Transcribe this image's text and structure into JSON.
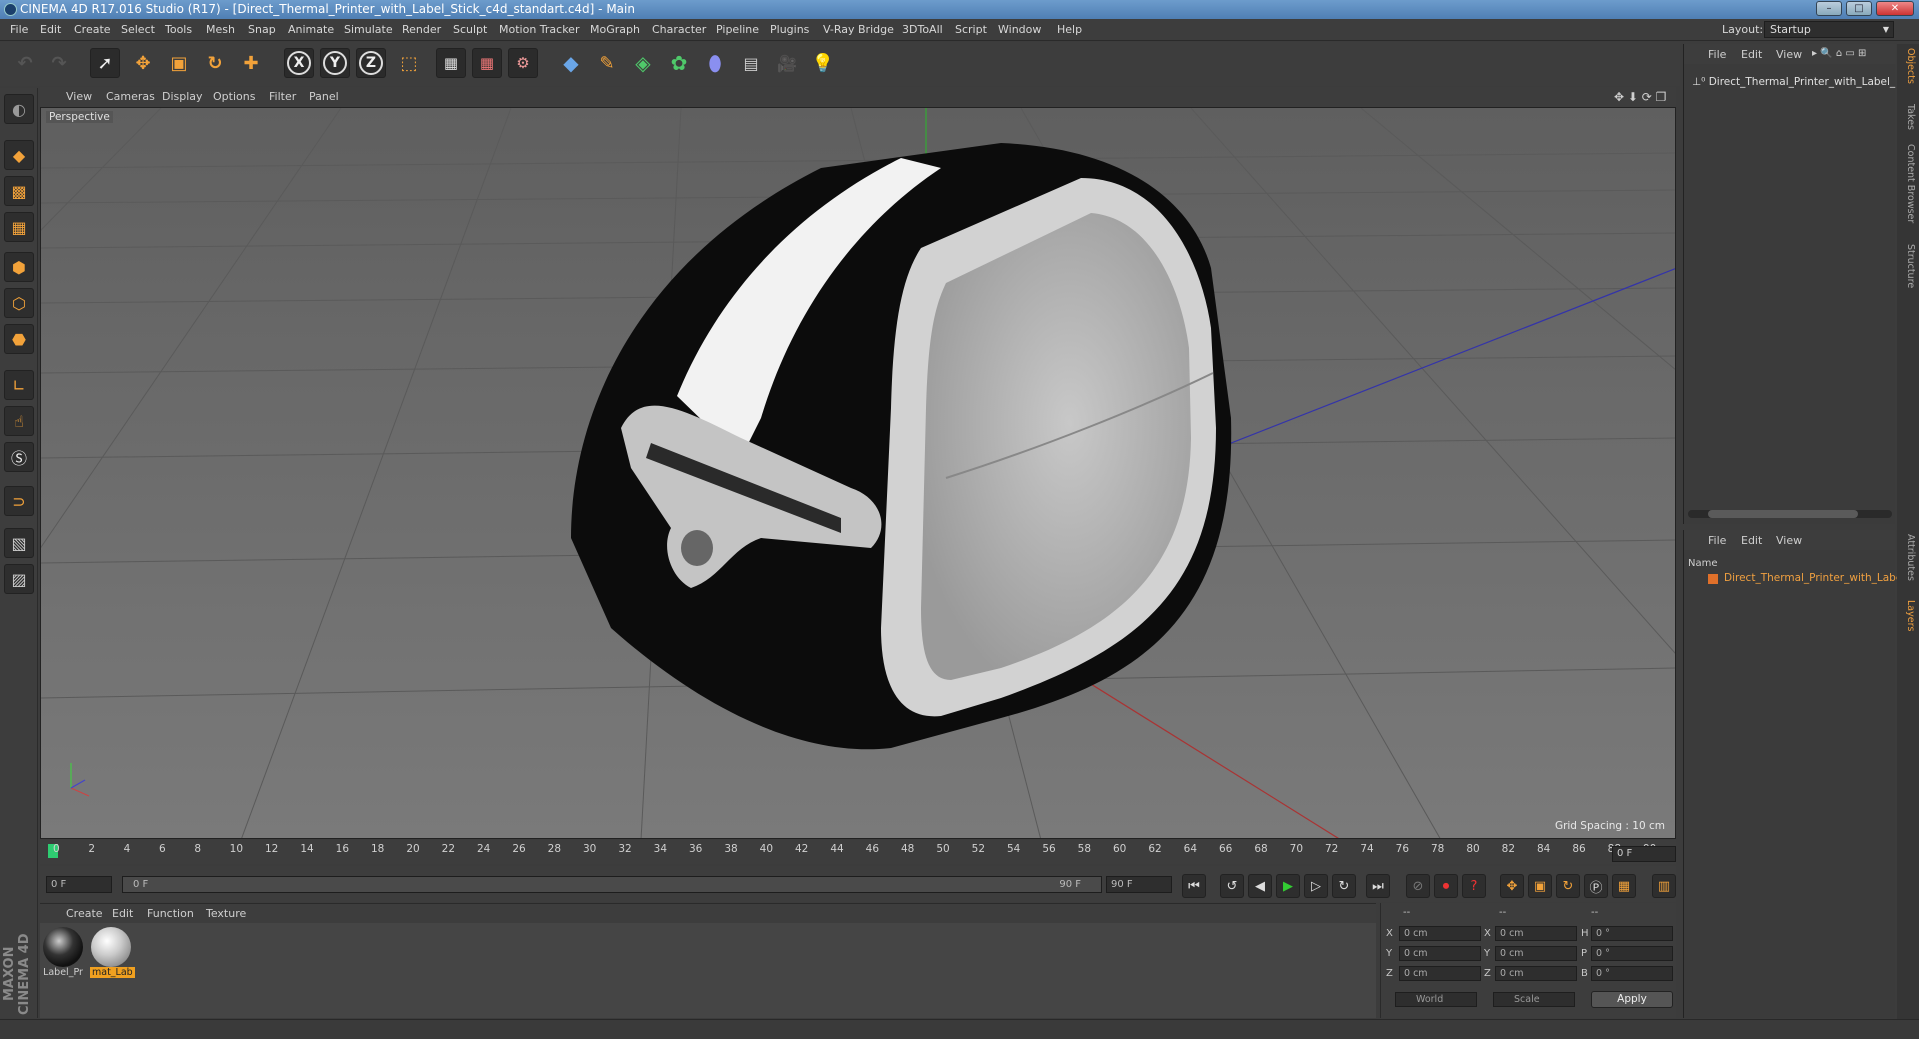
{
  "window": {
    "title": "CINEMA 4D R17.016 Studio (R17) - [Direct_Thermal_Printer_with_Label_Stick_c4d_standart.c4d] - Main"
  },
  "menu": [
    "File",
    "Edit",
    "Create",
    "Select",
    "Tools",
    "Mesh",
    "Snap",
    "Animate",
    "Simulate",
    "Render",
    "Sculpt",
    "Motion Tracker",
    "MoGraph",
    "Character",
    "Pipeline",
    "Plugins",
    "V-Ray Bridge",
    "3DToAll",
    "Script",
    "Window",
    "Help"
  ],
  "layout": {
    "label": "Layout:",
    "value": "Startup"
  },
  "toolbar": {
    "axis_x": "X",
    "axis_y": "Y",
    "axis_z": "Z"
  },
  "viewport": {
    "menu": [
      "View",
      "Cameras",
      "Display",
      "Options",
      "Filter",
      "Panel"
    ],
    "label": "Perspective",
    "grid_spacing": "Grid Spacing : 10 cm"
  },
  "timeline": {
    "ticks": [
      "0",
      "2",
      "4",
      "6",
      "8",
      "10",
      "12",
      "14",
      "16",
      "18",
      "20",
      "22",
      "24",
      "26",
      "28",
      "30",
      "32",
      "34",
      "36",
      "38",
      "40",
      "42",
      "44",
      "46",
      "48",
      "50",
      "52",
      "54",
      "56",
      "58",
      "60",
      "62",
      "64",
      "66",
      "68",
      "70",
      "72",
      "74",
      "76",
      "78",
      "80",
      "82",
      "84",
      "86",
      "88",
      "90"
    ],
    "current_frame": "0 F",
    "start": "0 F",
    "range_start": "0 F",
    "range_end": "90 F",
    "end": "90 F"
  },
  "materials": {
    "menu": [
      "Create",
      "Edit",
      "Function",
      "Texture"
    ],
    "items": [
      {
        "name": "Label_Pr"
      },
      {
        "name": "mat_Lab"
      }
    ]
  },
  "brand": "MAXON CINEMA 4D",
  "coordinates": {
    "header": [
      "--",
      "--",
      "--"
    ],
    "rows": [
      {
        "a": "X",
        "av": "0 cm",
        "b": "X",
        "bv": "0 cm",
        "c": "H",
        "cv": "0 °"
      },
      {
        "a": "Y",
        "av": "0 cm",
        "b": "Y",
        "bv": "0 cm",
        "c": "P",
        "cv": "0 °"
      },
      {
        "a": "Z",
        "av": "0 cm",
        "b": "Z",
        "bv": "0 cm",
        "c": "B",
        "cv": "0 °"
      }
    ],
    "mode": "World",
    "transform": "Scale",
    "apply": "Apply"
  },
  "objects": {
    "menu": [
      "File",
      "Edit",
      "View"
    ],
    "item": "Direct_Thermal_Printer_with_Label_"
  },
  "layers": {
    "menu": [
      "File",
      "Edit",
      "View"
    ],
    "header": "Name",
    "item": "Direct_Thermal_Printer_with_Label"
  },
  "side_tabs": [
    "Objects",
    "Takes",
    "Content Browser",
    "Structure",
    "Attributes",
    "Layers"
  ]
}
